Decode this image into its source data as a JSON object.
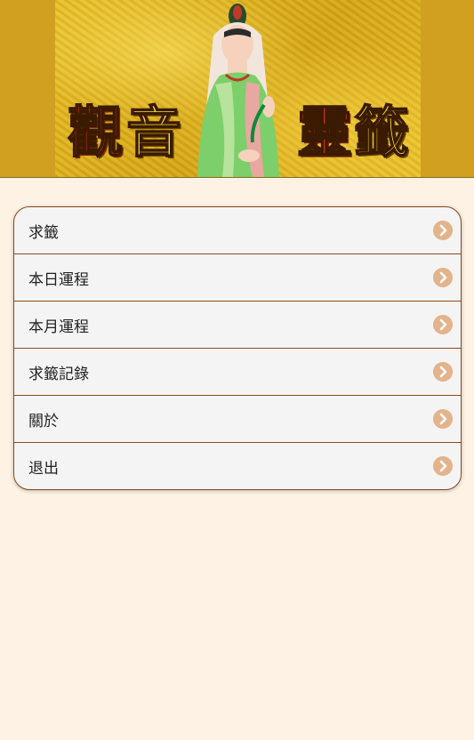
{
  "header": {
    "title_chars": [
      "觀",
      "音",
      "靈",
      "籤"
    ]
  },
  "menu": {
    "items": [
      {
        "label": "求籤"
      },
      {
        "label": "本日運程"
      },
      {
        "label": "本月運程"
      },
      {
        "label": "求籤記錄"
      },
      {
        "label": "關於"
      },
      {
        "label": "退出"
      }
    ],
    "chevron_icon": "chevron-right-icon"
  },
  "colors": {
    "page_bg": "#fdf2e3",
    "header_bg": "#d1a021",
    "menu_border": "#8a4a1e",
    "chevron": "#e3b48c"
  }
}
